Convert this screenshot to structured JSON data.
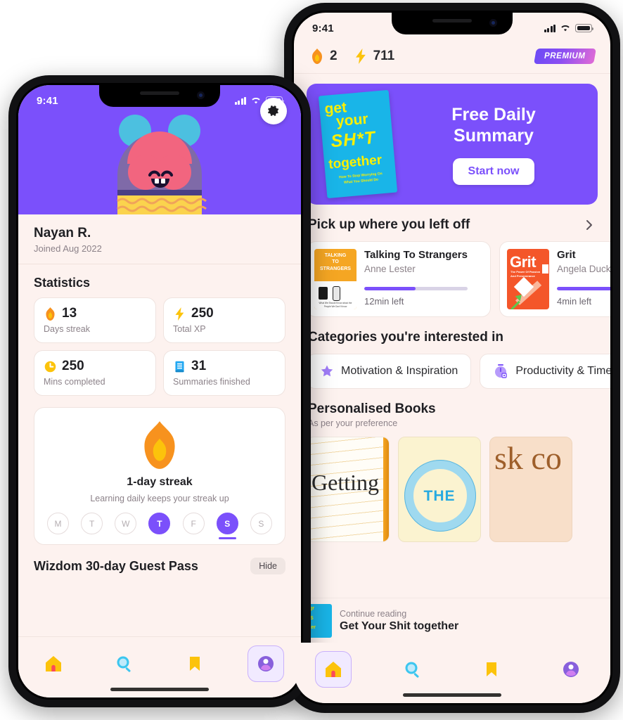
{
  "app": {
    "accent_purple": "#7b50fb",
    "bg_cream": "#fdf2ef",
    "yellow": "#fcc30b",
    "cyan": "#3dc6ef"
  },
  "left_phone": {
    "status_bar": {
      "time": "9:41",
      "signal_icon": "cellular-bars-icon",
      "wifi_icon": "wifi-icon",
      "battery_icon": "battery-icon"
    },
    "settings_icon": "gear-icon",
    "avatar": {
      "icon": "avatar-character",
      "ears_color": "#4cc0e0",
      "head_color": "#f2657f",
      "body_color": "#7f6aa8",
      "band_color": "#fbd34d"
    },
    "profile": {
      "name": "Nayan R.",
      "joined": "Joined Aug 2022"
    },
    "statistics": {
      "title": "Statistics",
      "cards": [
        {
          "icon": "flame-icon",
          "value": "13",
          "label": "Days streak"
        },
        {
          "icon": "bolt-icon",
          "value": "250",
          "label": "Total XP"
        },
        {
          "icon": "clock-icon",
          "value": "250",
          "label": "Mins completed"
        },
        {
          "icon": "book-icon",
          "value": "31",
          "label": "Summaries finished"
        }
      ]
    },
    "streak": {
      "icon": "flame-icon",
      "title": "1-day streak",
      "subtitle": "Learning daily keeps your streak up",
      "days": [
        {
          "label": "M",
          "active": false,
          "today": false
        },
        {
          "label": "T",
          "active": false,
          "today": false
        },
        {
          "label": "W",
          "active": false,
          "today": false
        },
        {
          "label": "T",
          "active": true,
          "today": false
        },
        {
          "label": "F",
          "active": false,
          "today": false
        },
        {
          "label": "S",
          "active": true,
          "today": true
        },
        {
          "label": "S",
          "active": false,
          "today": false
        }
      ]
    },
    "guest_pass": {
      "title": "Wizdom 30-day Guest Pass",
      "hide_label": "Hide"
    },
    "tabs": [
      {
        "name": "home",
        "icon": "home-icon",
        "active": false
      },
      {
        "name": "search",
        "icon": "search-icon",
        "active": false
      },
      {
        "name": "bookmark",
        "icon": "bookmark-icon",
        "active": false
      },
      {
        "name": "profile",
        "icon": "profile-icon",
        "active": true
      }
    ]
  },
  "right_phone": {
    "status_bar": {
      "time": "9:41",
      "signal_icon": "cellular-bars-icon",
      "wifi_icon": "wifi-icon",
      "battery_icon": "battery-icon"
    },
    "header": {
      "streak_icon": "flame-icon",
      "streak_value": "2",
      "xp_icon": "bolt-icon",
      "xp_value": "711",
      "premium_label": "PREMIUM"
    },
    "banner": {
      "title_line1": "Free Daily",
      "title_line2": "Summary",
      "cta_label": "Start now",
      "book_cover": {
        "line1": "get",
        "line2": "your",
        "line3": "SH*T",
        "line4": "together",
        "sub1": "How To Stop Worrying On",
        "sub2": "What You Should Do"
      }
    },
    "continue_section": {
      "title": "Pick up where you left off",
      "chevron_icon": "chevron-right-icon",
      "items": [
        {
          "cover_text": "TALKING TO STRANGERS",
          "title": "Talking To Strangers",
          "author": "Anne Lester",
          "progress": 50,
          "time_left": "12min left"
        },
        {
          "cover_text": "Grit",
          "cover_sub": "The Power Of Passion And Perseverance",
          "title": "Grit",
          "author": "Angela Duckworth",
          "progress": 78,
          "time_left": "4min left"
        }
      ]
    },
    "categories_section": {
      "title": "Categories you're interested in",
      "items": [
        {
          "icon": "star-icon",
          "label": "Motivation & Inspiration"
        },
        {
          "icon": "stopwatch-icon",
          "label": "Productivity & Time"
        }
      ]
    },
    "personalised_section": {
      "title": "Personalised Books",
      "subtitle": "As per your preference",
      "books": [
        {
          "title": "Getting",
          "style": "lined-paper"
        },
        {
          "title": "THE",
          "style": "clock-dial"
        },
        {
          "title": "sk co",
          "style": "serif-peach"
        }
      ]
    },
    "mini_player": {
      "label": "Continue reading",
      "title": "Get Your Shit together"
    },
    "tabs": [
      {
        "name": "home",
        "icon": "home-icon",
        "active": true
      },
      {
        "name": "search",
        "icon": "search-icon",
        "active": false
      },
      {
        "name": "bookmark",
        "icon": "bookmark-icon",
        "active": false
      },
      {
        "name": "profile",
        "icon": "profile-icon",
        "active": false
      }
    ]
  }
}
